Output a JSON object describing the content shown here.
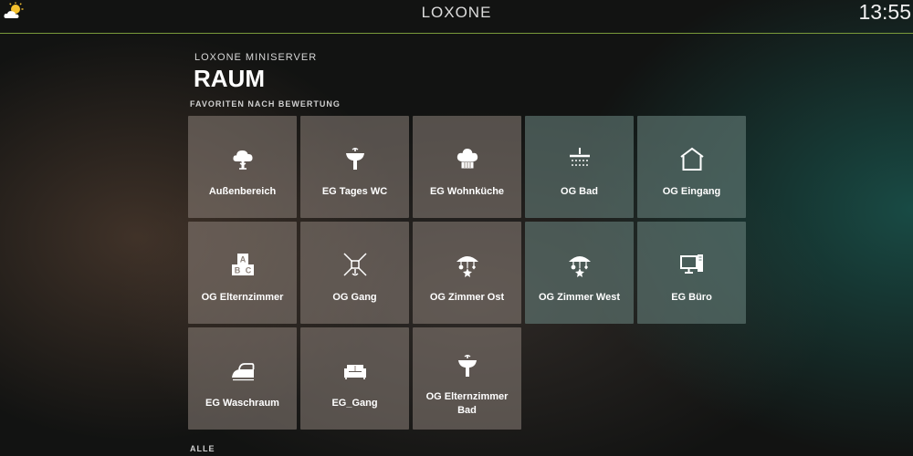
{
  "header": {
    "app_title": "LOXONE",
    "time": "13:55",
    "weather_icon": "partly-cloudy-icon"
  },
  "subtitle": "LOXONE MINISERVER",
  "title": "RAUM",
  "sections": {
    "favorites": "FAVORITEN NACH BEWERTUNG",
    "all": "ALLE"
  },
  "rooms": [
    {
      "name": "Außenbereich",
      "icon": "tree-icon"
    },
    {
      "name": "EG Tages WC",
      "icon": "sink-icon"
    },
    {
      "name": "EG Wohnküche",
      "icon": "chef-hat-icon"
    },
    {
      "name": "OG Bad",
      "icon": "shower-icon"
    },
    {
      "name": "OG Eingang",
      "icon": "house-icon"
    },
    {
      "name": "OG Elternzimmer",
      "icon": "abc-blocks-icon"
    },
    {
      "name": "OG Gang",
      "icon": "ceiling-lamp-icon"
    },
    {
      "name": "OG Zimmer Ost",
      "icon": "baby-mobile-icon"
    },
    {
      "name": "OG Zimmer West",
      "icon": "baby-mobile-icon"
    },
    {
      "name": "EG Büro",
      "icon": "computer-icon"
    },
    {
      "name": "EG Waschraum",
      "icon": "iron-icon"
    },
    {
      "name": "EG_Gang",
      "icon": "sofa-icon"
    },
    {
      "name": "OG Elternzimmer Bad",
      "icon": "sink-icon"
    }
  ],
  "colors": {
    "tile": "#8c827a",
    "tile_teal": "#647d78",
    "header_line": "#7a9a3a"
  }
}
